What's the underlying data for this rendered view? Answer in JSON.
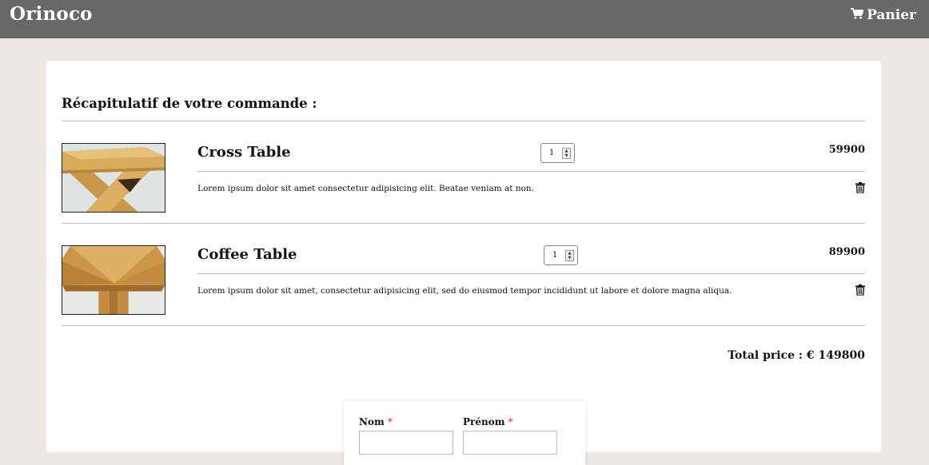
{
  "header": {
    "brand": "Orinoco",
    "cart_label": "Panier",
    "cart_icon": "shopping-cart-icon"
  },
  "summary": {
    "title": "Récapitulatif de votre commande :",
    "items": [
      {
        "name": "Cross Table",
        "quantity": "1",
        "price": "59900",
        "description": "Lorem ipsum dolor sit amet consectetur adipisicing elit. Beatae veniam at non.",
        "delete_icon": "trash-icon"
      },
      {
        "name": "Coffee Table",
        "quantity": "1",
        "price": "89900",
        "description": "Lorem ipsum dolor sit amet, consectetur adipisicing elit, sed do eiusmod tempor incididunt ut labore et dolore magna aliqua.",
        "delete_icon": "trash-icon"
      }
    ],
    "total": "Total price : € 149800"
  },
  "form": {
    "nom_label": "Nom",
    "prenom_label": "Prénom",
    "required_mark": "*"
  },
  "colors": {
    "navbar": "#686868",
    "page_bg": "#ede7e4",
    "required": "#dd2222"
  }
}
